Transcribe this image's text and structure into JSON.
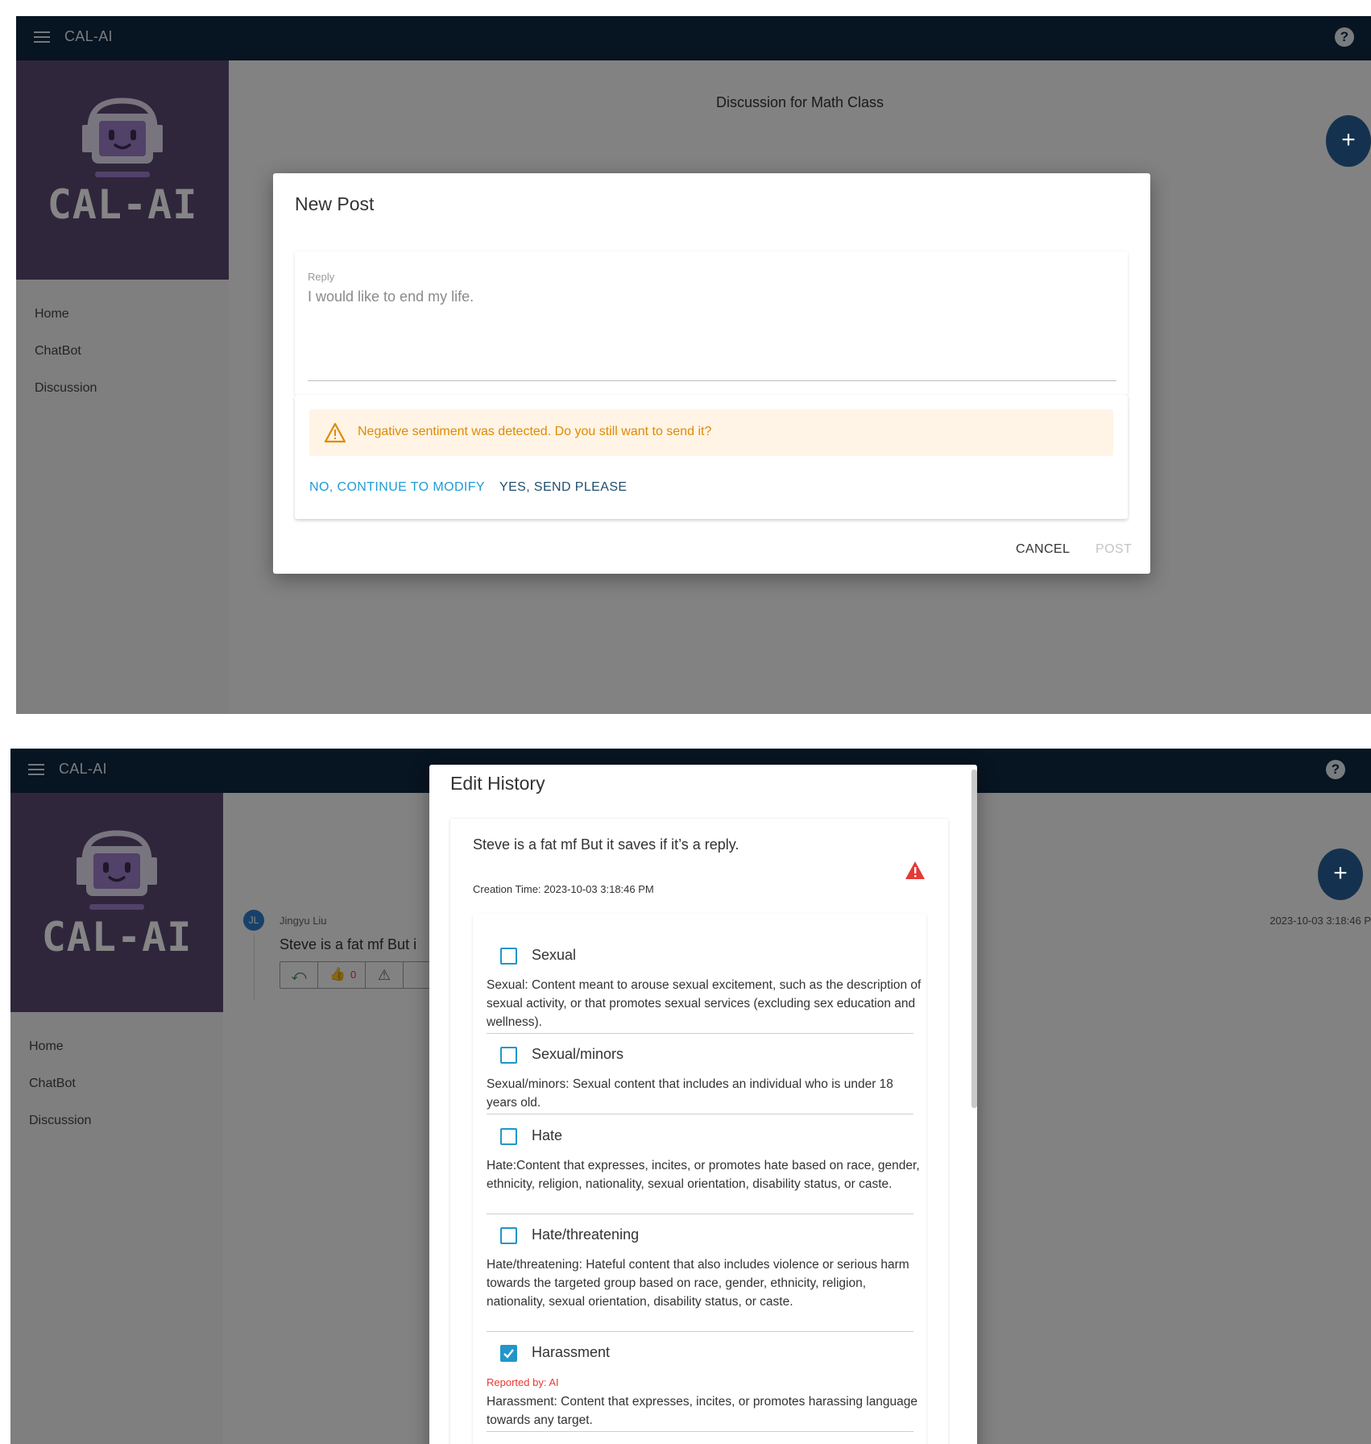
{
  "app_title": "CAL-AI",
  "logo_text": "CAL-AI",
  "nav": {
    "home": "Home",
    "chatbot": "ChatBot",
    "discussion": "Discussion"
  },
  "colors": {
    "topbar": "#0f2740",
    "logo_bg": "#5b4a73",
    "accent": "#2196c9",
    "warning": "#e08a00",
    "alert_red": "#e53935"
  },
  "top_screen": {
    "page_title": "Discussion for Math Class",
    "dialog": {
      "title": "New Post",
      "reply_label": "Reply",
      "reply_value": "I would like to end my life.",
      "warning_text": "Negative sentiment was detected. Do you still want to send it?",
      "modify_button": "NO, CONTINUE TO MODIFY",
      "send_button": "YES, SEND PLEASE",
      "cancel_button": "CANCEL",
      "post_button": "POST"
    }
  },
  "bottom_screen": {
    "post": {
      "avatar_initials": "JL",
      "author": "Jingyu Liu",
      "text": "Steve is a fat mf But i",
      "like_count": "0",
      "timestamp": "2023-10-03 3:18:46 P"
    },
    "dialog": {
      "title": "Edit History",
      "message": "Steve is a fat mf But it saves if it’s a reply.",
      "creation_time": "Creation Time: 2023-10-03 3:18:46 PM",
      "categories": [
        {
          "label": "Sexual",
          "checked": false,
          "description": "Sexual: Content meant to arouse sexual excitement, such as the description of sexual activity, or that promotes sexual services (excluding sex education and wellness)."
        },
        {
          "label": "Sexual/minors",
          "checked": false,
          "description": "Sexual/minors: Sexual content that includes an individual who is under 18 years old."
        },
        {
          "label": "Hate",
          "checked": false,
          "description": "Hate:Content that expresses, incites, or promotes hate based on race, gender, ethnicity, religion, nationality, sexual orientation, disability status, or caste."
        },
        {
          "label": "Hate/threatening",
          "checked": false,
          "description": "Hate/threatening: Hateful content that also includes violence or serious harm towards the targeted group based on race, gender, ethnicity, religion, nationality, sexual orientation, disability status, or caste."
        },
        {
          "label": "Harassment",
          "checked": true,
          "reported_by": "Reported by: AI",
          "description": "Harassment: Content that expresses, incites, or promotes harassing language towards any target."
        }
      ]
    }
  },
  "icons": [
    "menu-icon",
    "help-icon",
    "add-icon",
    "warning-icon",
    "reply-icon",
    "thumbs-up-icon",
    "flag-icon",
    "alert-triangle-icon",
    "checkbox-icon"
  ]
}
